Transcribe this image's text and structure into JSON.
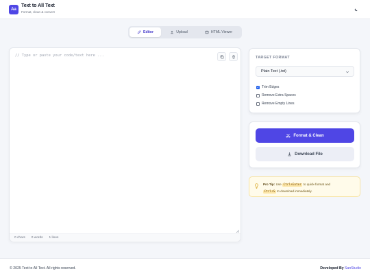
{
  "header": {
    "logo_text": "Aa",
    "title": "Text to All Text",
    "subtitle": "Format, clean & convert",
    "theme_icon": "moon-icon"
  },
  "tabs": [
    {
      "label": "Editor",
      "icon": "pencil-icon",
      "active": true
    },
    {
      "label": "Upload",
      "icon": "upload-icon",
      "active": false
    },
    {
      "label": "HTML Viewer",
      "icon": "window-icon",
      "active": false
    }
  ],
  "editor": {
    "placeholder": "// Type or paste your code/text here ...",
    "copy_icon": "copy-icon",
    "delete_icon": "trash-icon",
    "stats": {
      "chars": "0 chars",
      "words": "0 words",
      "lines": "1 lines"
    }
  },
  "format": {
    "title": "TARGET FORMAT",
    "selected": "Plain Text (.txt)",
    "options": [
      {
        "label": "Trim Edges",
        "checked": true
      },
      {
        "label": "Remove Extra Spaces",
        "checked": false
      },
      {
        "label": "Remove Empty Lines",
        "checked": false
      }
    ]
  },
  "actions": {
    "primary": "Format & Clean",
    "secondary": "Download File"
  },
  "tip": {
    "label": "Pro Tip:",
    "use": "Use",
    "key1": "Ctrl+Enter",
    "mid": "to quick-format and",
    "key2": "Ctrl+S",
    "end": "to download immediately."
  },
  "footer": {
    "copyright": "© 2025 Text to All Text. All rights reserved.",
    "credit_prefix": "Developed By",
    "credit_brand": "SanStudio"
  },
  "colors": {
    "accent": "#4f46e5",
    "background": "#f4f6fa",
    "tip_background": "#fffbea"
  }
}
